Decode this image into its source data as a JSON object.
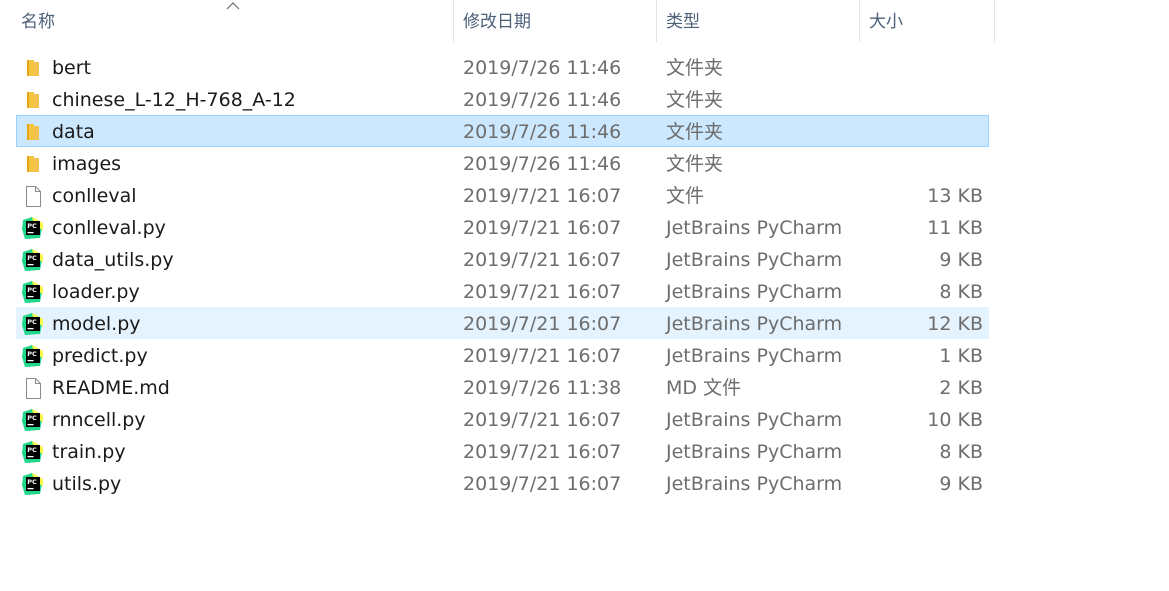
{
  "columns": {
    "name": "名称",
    "date": "修改日期",
    "type": "类型",
    "size": "大小"
  },
  "files": [
    {
      "name": "bert",
      "date": "2019/7/26 11:46",
      "type": "文件夹",
      "size": "",
      "icon": "folder-icon",
      "state": ""
    },
    {
      "name": "chinese_L-12_H-768_A-12",
      "date": "2019/7/26 11:46",
      "type": "文件夹",
      "size": "",
      "icon": "folder-icon",
      "state": ""
    },
    {
      "name": "data",
      "date": "2019/7/26 11:46",
      "type": "文件夹",
      "size": "",
      "icon": "folder-icon",
      "state": "selected"
    },
    {
      "name": "images",
      "date": "2019/7/26 11:46",
      "type": "文件夹",
      "size": "",
      "icon": "folder-icon",
      "state": ""
    },
    {
      "name": "conlleval",
      "date": "2019/7/21 16:07",
      "type": "文件",
      "size": "13 KB",
      "icon": "file-icon",
      "state": ""
    },
    {
      "name": "conlleval.py",
      "date": "2019/7/21 16:07",
      "type": "JetBrains PyCharm",
      "size": "11 KB",
      "icon": "pycharm-icon",
      "state": ""
    },
    {
      "name": "data_utils.py",
      "date": "2019/7/21 16:07",
      "type": "JetBrains PyCharm",
      "size": "9 KB",
      "icon": "pycharm-icon",
      "state": ""
    },
    {
      "name": "loader.py",
      "date": "2019/7/21 16:07",
      "type": "JetBrains PyCharm",
      "size": "8 KB",
      "icon": "pycharm-icon",
      "state": ""
    },
    {
      "name": "model.py",
      "date": "2019/7/21 16:07",
      "type": "JetBrains PyCharm",
      "size": "12 KB",
      "icon": "pycharm-icon",
      "state": "hover"
    },
    {
      "name": "predict.py",
      "date": "2019/7/21 16:07",
      "type": "JetBrains PyCharm",
      "size": "1 KB",
      "icon": "pycharm-icon",
      "state": ""
    },
    {
      "name": "README.md",
      "date": "2019/7/26 11:38",
      "type": "MD 文件",
      "size": "2 KB",
      "icon": "file-icon",
      "state": ""
    },
    {
      "name": "rnncell.py",
      "date": "2019/7/21 16:07",
      "type": "JetBrains PyCharm",
      "size": "10 KB",
      "icon": "pycharm-icon",
      "state": ""
    },
    {
      "name": "train.py",
      "date": "2019/7/21 16:07",
      "type": "JetBrains PyCharm",
      "size": "8 KB",
      "icon": "pycharm-icon",
      "state": ""
    },
    {
      "name": "utils.py",
      "date": "2019/7/21 16:07",
      "type": "JetBrains PyCharm",
      "size": "9 KB",
      "icon": "pycharm-icon",
      "state": ""
    }
  ],
  "colors": {
    "selected_bg": "#cce8ff",
    "selected_border": "#99d1ff",
    "hover_bg": "#e5f3ff",
    "header_text": "#4c607a",
    "secondary_text": "#6d6d6d",
    "folder": "#f2c14e"
  }
}
